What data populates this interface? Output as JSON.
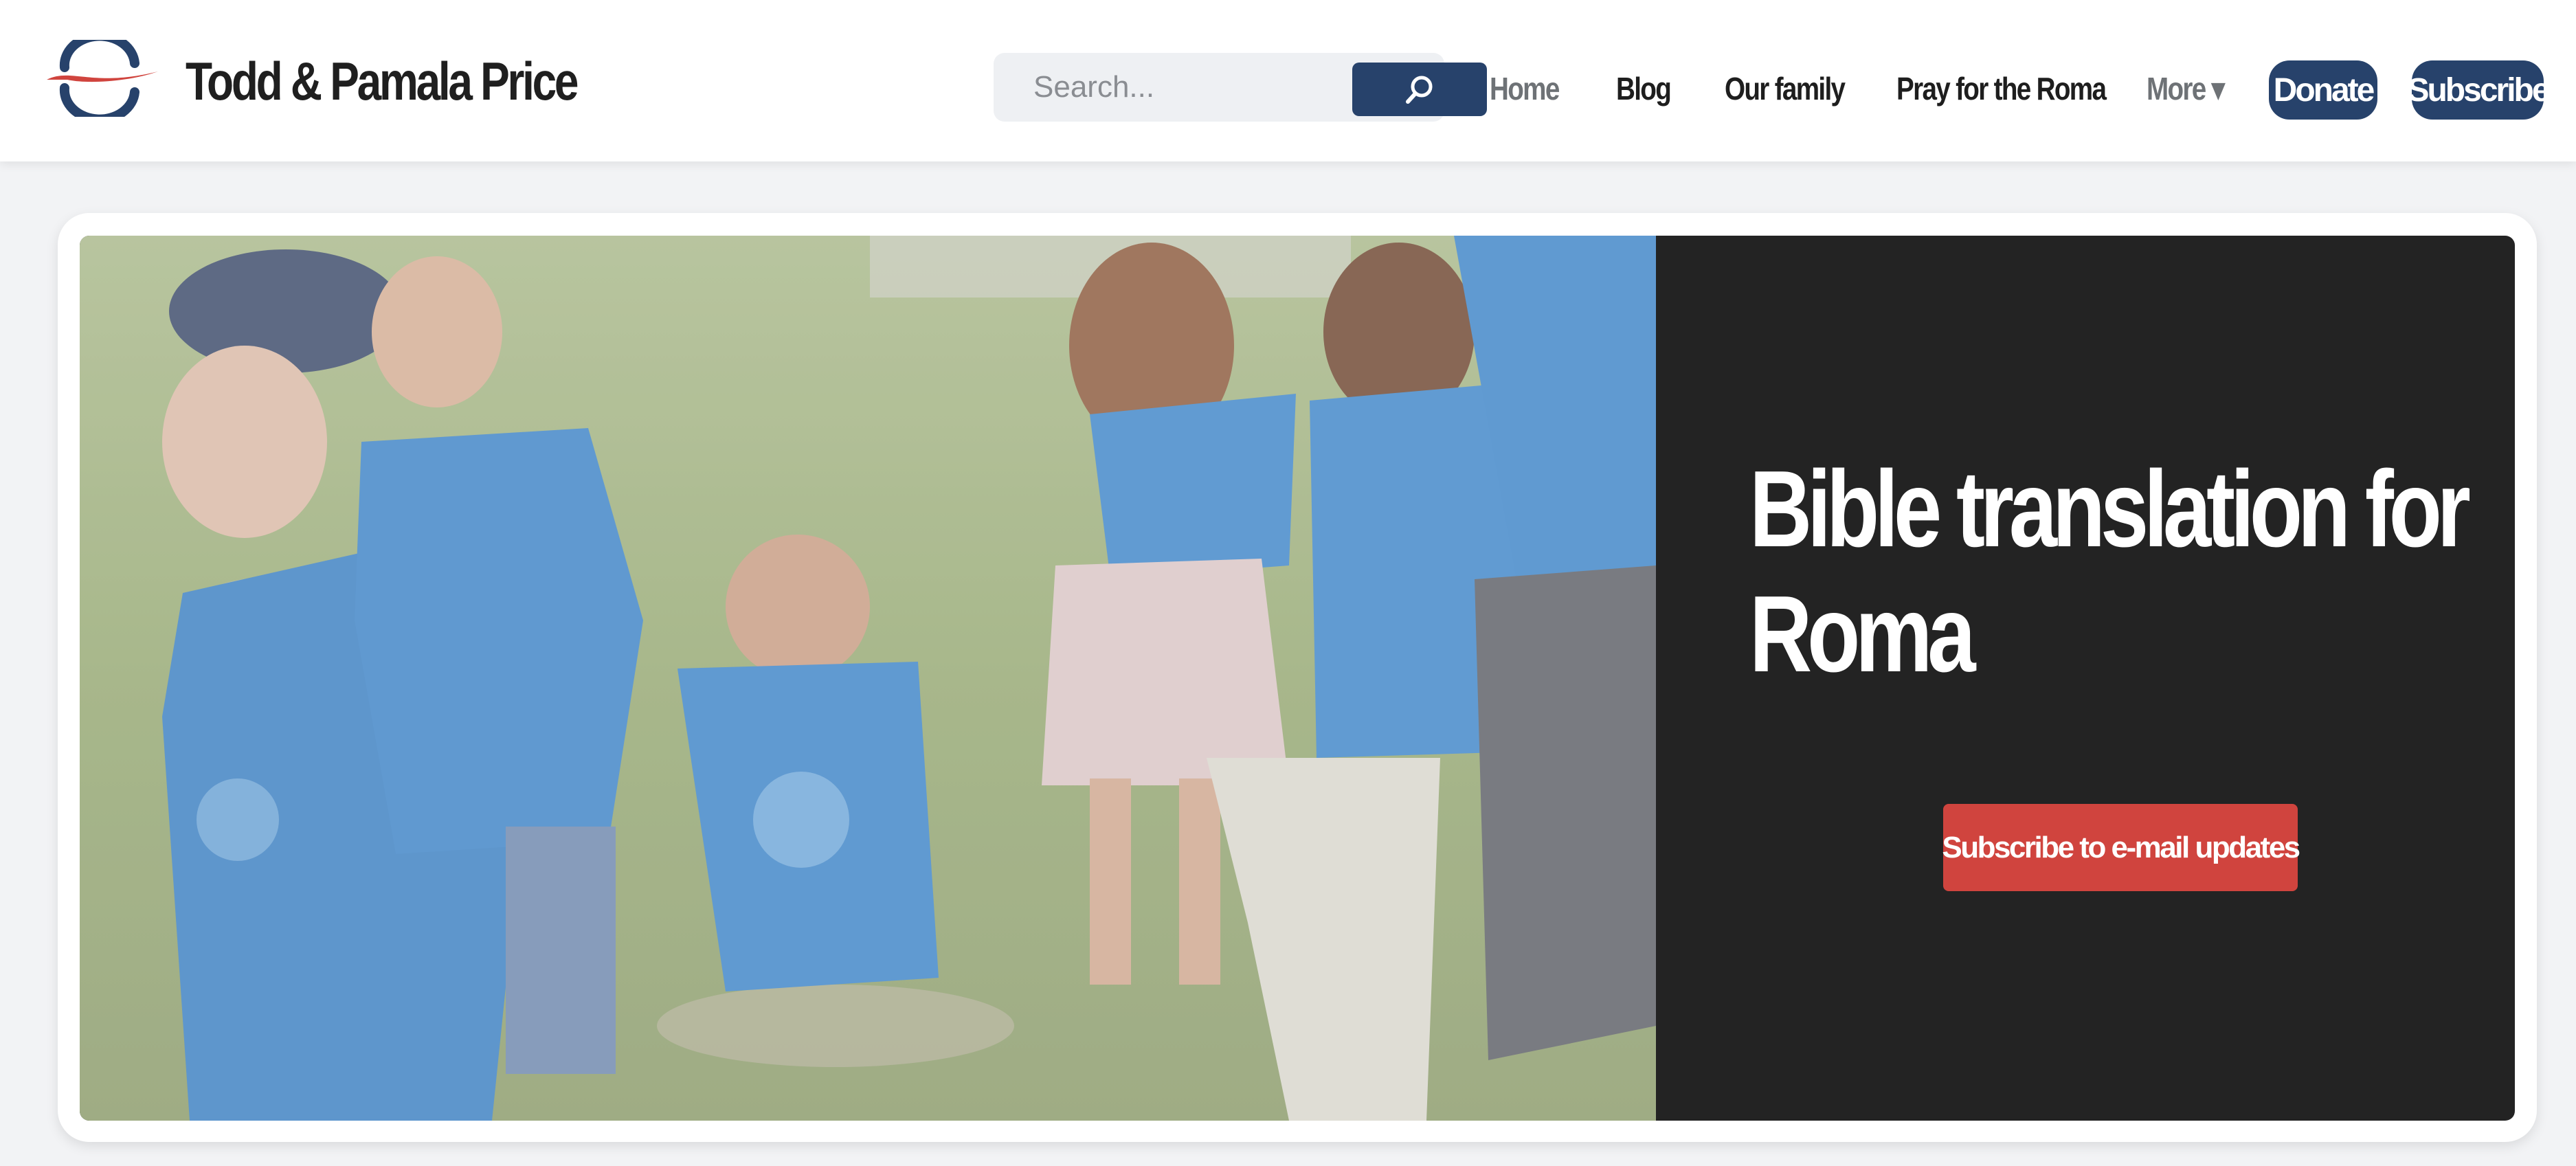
{
  "site": {
    "title": "Todd & Pamala Price"
  },
  "search": {
    "placeholder": "Search...",
    "icon": "search-icon"
  },
  "nav": {
    "items": [
      {
        "label": "Home"
      },
      {
        "label": "Blog"
      },
      {
        "label": "Our family"
      },
      {
        "label": "Pray for the Roma"
      },
      {
        "label": "More ▾"
      }
    ],
    "donate_label": "Donate",
    "subscribe_label": "Subscribe"
  },
  "hero": {
    "headline_line1": "Bible translation for",
    "headline_line2": "Roma",
    "cta_label": "Subscribe to e-mail updates"
  },
  "colors": {
    "brand_navy": "#27426b",
    "cta_red": "#d0443e",
    "hero_dark": "#232323",
    "page_bg": "#f2f3f5"
  }
}
